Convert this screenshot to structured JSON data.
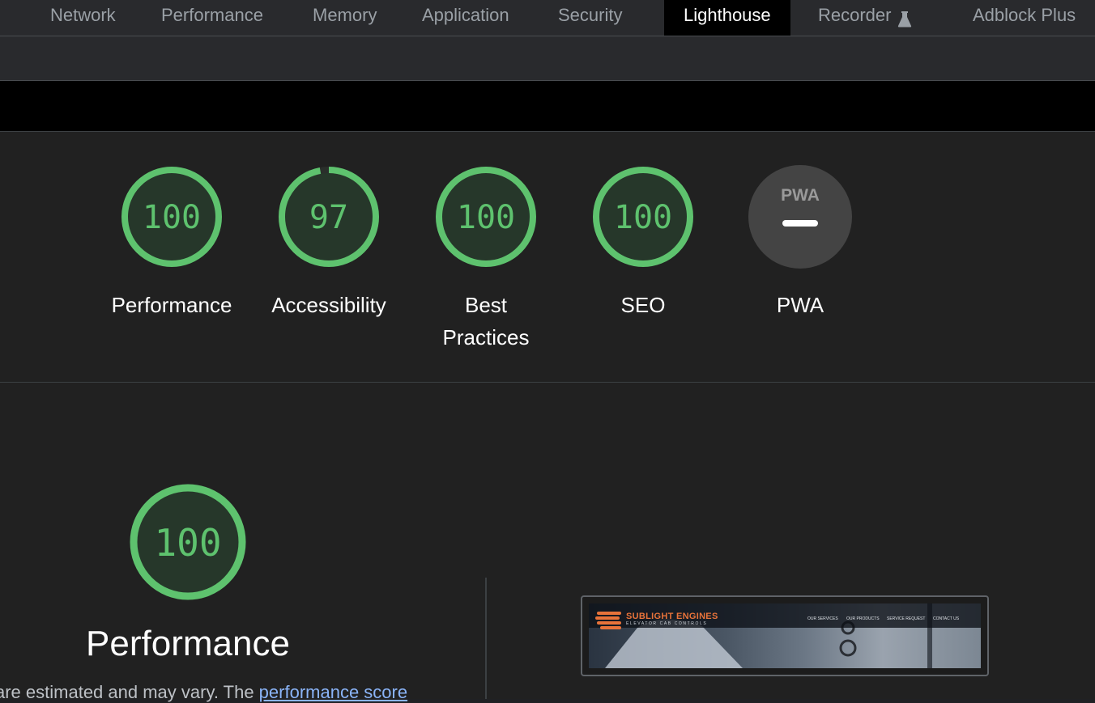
{
  "tabs": [
    {
      "label": "Network",
      "active": false
    },
    {
      "label": "Performance",
      "active": false
    },
    {
      "label": "Memory",
      "active": false
    },
    {
      "label": "Application",
      "active": false
    },
    {
      "label": "Security",
      "active": false
    },
    {
      "label": "Lighthouse",
      "active": true
    },
    {
      "label": "Recorder",
      "active": false,
      "icon": "flask-icon"
    },
    {
      "label": "Adblock Plus",
      "active": false
    }
  ],
  "scores": [
    {
      "label": "Performance",
      "value": 100,
      "display": "100"
    },
    {
      "label": "Accessibility",
      "value": 97,
      "display": "97"
    },
    {
      "label": "Best Practices",
      "value": 100,
      "display": "100"
    },
    {
      "label": "SEO",
      "value": 100,
      "display": "100"
    },
    {
      "label": "PWA",
      "value": null,
      "display": "—",
      "badge": "PWA"
    }
  ],
  "performance_section": {
    "score": 100,
    "score_display": "100",
    "title": "Performance",
    "description_prefix": "are estimated and may vary. The ",
    "description_link": "performance score"
  },
  "screenshot": {
    "brand": "SUBLIGHT ENGINES",
    "tagline": "ELEVATOR CAB CONTROLS",
    "nav": [
      "OUR SERVICES",
      "OUR PRODUCTS",
      "SERVICE REQUEST",
      "CONTACT US"
    ]
  },
  "colors": {
    "pass_green": "#5ec26e",
    "pass_fill": "#26372a",
    "pwa_gray": "#444444",
    "link_blue": "#8ab4f8",
    "accent_orange": "#e8733a"
  }
}
